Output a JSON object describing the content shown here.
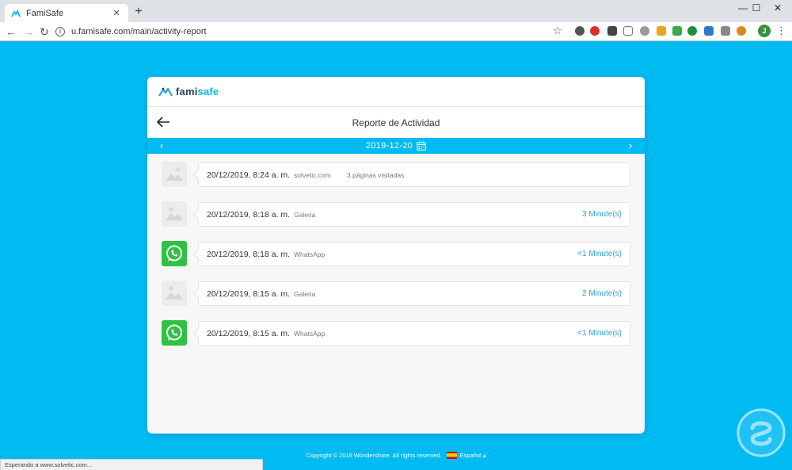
{
  "browser": {
    "tab_title": "FamiSafe",
    "tab_close": "✕",
    "new_tab": "+",
    "url": "u.famisafe.com/main/activity-report",
    "profile_initial": "J",
    "status_text": "Esperando a www.solvetic.com..."
  },
  "app": {
    "logo_prefix": "fami",
    "logo_suffix": "safe",
    "page_title": "Reporte de Actividad",
    "date": "2019-12-20",
    "icon_colors": {
      "accent": "#00baf2",
      "whatsapp": "#2fc143"
    }
  },
  "activities": [
    {
      "icon": "image-placeholder-icon",
      "time": "20/12/2019, 8:24 a. m.",
      "app": "solvetic.com",
      "detail": "3 páginas visitadas",
      "duration": ""
    },
    {
      "icon": "gallery-placeholder-icon",
      "time": "20/12/2019, 8:18 a. m.",
      "app": "Galeria",
      "detail": "",
      "duration": "3 Minute(s)"
    },
    {
      "icon": "whatsapp-icon",
      "time": "20/12/2019, 8:18 a. m.",
      "app": "WhatsApp",
      "detail": "",
      "duration": "<1 Minute(s)"
    },
    {
      "icon": "gallery-placeholder-icon",
      "time": "20/12/2019, 8:15 a. m.",
      "app": "Galeria",
      "detail": "",
      "duration": "2 Minute(s)"
    },
    {
      "icon": "whatsapp-icon",
      "time": "20/12/2019, 8:15 a. m.",
      "app": "WhatsApp",
      "detail": "",
      "duration": "<1 Minute(s)"
    }
  ],
  "footer": {
    "copyright": "Copyright © 2019 Wondershare. All rights reserved.",
    "language": "Español"
  }
}
